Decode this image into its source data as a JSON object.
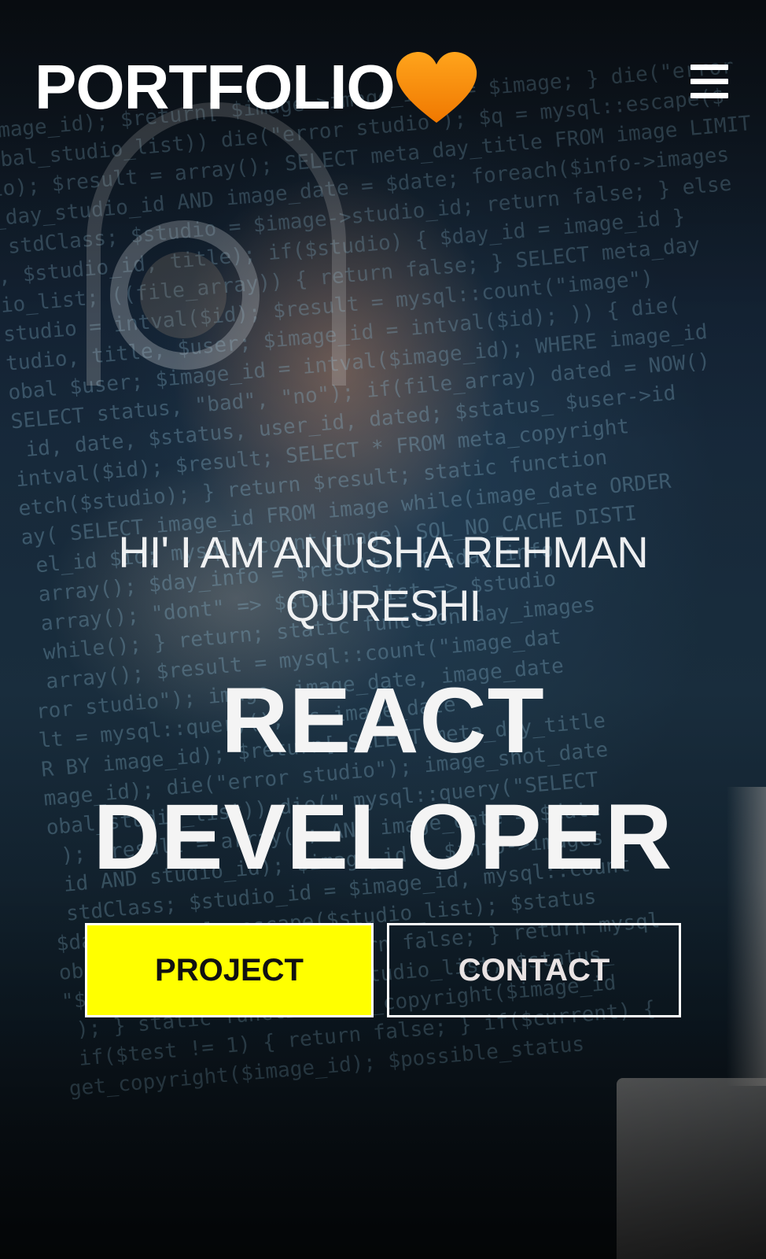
{
  "header": {
    "logo_text": "PORTFOLIO",
    "logo_emoji": "orange-heart",
    "menu_icon": "hamburger-menu-icon"
  },
  "hero": {
    "greeting": "HI' I AM ANUSHA REHMAN QURESHI",
    "role_line1": "REACT",
    "role_line2": "DEVELOPER"
  },
  "buttons": {
    "project_label": "PROJECT",
    "contact_label": "CONTACT"
  },
  "colors": {
    "project_button_bg": "#ffff00",
    "heart": "#ff8c00",
    "text": "#ffffff"
  }
}
